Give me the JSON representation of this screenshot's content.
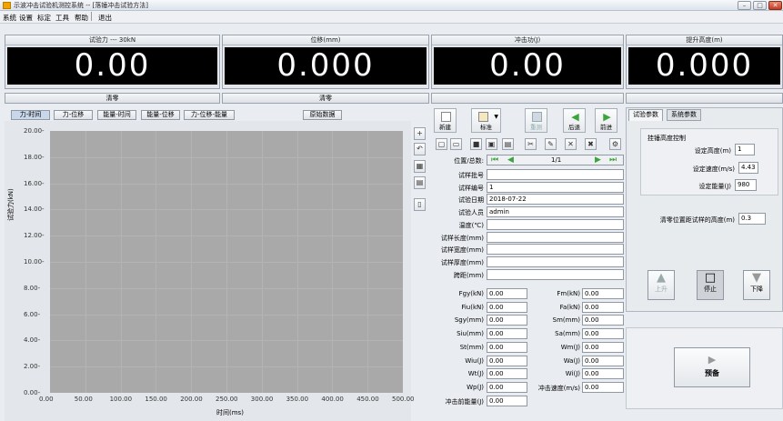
{
  "window": {
    "title": "示波冲击试验机测控系统 -- [落锤冲击试验方法]"
  },
  "menu": [
    "系统",
    "设置",
    "标定",
    "工具",
    "帮助",
    "退出"
  ],
  "displays": [
    {
      "caption": "试验力 --- 30kN",
      "value": "0.00"
    },
    {
      "caption": "位移(mm)",
      "value": "0.000"
    },
    {
      "caption": "冲击功(J)",
      "value": "0.00"
    },
    {
      "caption": "提升高度(m)",
      "value": "0.000"
    }
  ],
  "zero_buttons": [
    "清零",
    "清零"
  ],
  "chart_tabs": [
    "力-时间",
    "力-位移",
    "能量-时间",
    "能量-位移",
    "力-位移-能量"
  ],
  "raw_data_button": "原始数据",
  "chart_data": {
    "type": "line",
    "title": "",
    "xlabel": "时间(ms)",
    "ylabel": "试验力(kN)",
    "xlim": [
      0,
      500
    ],
    "ylim": [
      0,
      20
    ],
    "x_ticks": [
      "0.00",
      "50.00",
      "100.00",
      "150.00",
      "200.00",
      "250.00",
      "300.00",
      "350.00",
      "400.00",
      "450.00",
      "500.00"
    ],
    "y_ticks": [
      "0.00-",
      "2.00-",
      "4.00-",
      "6.00-",
      "8.00-",
      "10.00-",
      "12.00-",
      "14.00-",
      "16.00-",
      "18.00-",
      "20.00-"
    ],
    "series": [],
    "grid": true
  },
  "toolbar": {
    "new": "新建",
    "standard": "标准",
    "reset": "重测",
    "back": "后退",
    "forward": "前进"
  },
  "record": {
    "position_label": "位置/总数:",
    "position_value": "1/1"
  },
  "fields": [
    {
      "label": "试样批号",
      "value": ""
    },
    {
      "label": "试样编号",
      "value": "1"
    },
    {
      "label": "试验日期",
      "value": "2018-07-22"
    },
    {
      "label": "试验人员",
      "value": "admin"
    },
    {
      "label": "温度(℃)",
      "value": ""
    },
    {
      "label": "试样长度(mm)",
      "value": ""
    },
    {
      "label": "试样宽度(mm)",
      "value": ""
    },
    {
      "label": "试样厚度(mm)",
      "value": ""
    },
    {
      "label": "跨距(mm)",
      "value": ""
    }
  ],
  "results_left": [
    {
      "label": "Fgy(kN)",
      "value": "0.00"
    },
    {
      "label": "Fiu(kN)",
      "value": "0.00"
    },
    {
      "label": "Sgy(mm)",
      "value": "0.00"
    },
    {
      "label": "Siu(mm)",
      "value": "0.00"
    },
    {
      "label": "St(mm)",
      "value": "0.00"
    },
    {
      "label": "Wiu(J)",
      "value": "0.00"
    },
    {
      "label": "Wt(J)",
      "value": "0.00"
    },
    {
      "label": "Wp(J)",
      "value": "0.00"
    },
    {
      "label": "冲击前能量(J)",
      "value": "0.00"
    }
  ],
  "results_right": [
    {
      "label": "Fm(kN)",
      "value": "0.00"
    },
    {
      "label": "Fa(kN)",
      "value": "0.00"
    },
    {
      "label": "Sm(mm)",
      "value": "0.00"
    },
    {
      "label": "Sa(mm)",
      "value": "0.00"
    },
    {
      "label": "Wm(J)",
      "value": "0.00"
    },
    {
      "label": "Wa(J)",
      "value": "0.00"
    },
    {
      "label": "Wi(J)",
      "value": "0.00"
    },
    {
      "label": "冲击速度(m/s)",
      "value": "0.00"
    }
  ],
  "right_panel": {
    "tabs": [
      "试验参数",
      "系统参数"
    ],
    "group_title": "挂锤高度控制",
    "set_height_label": "设定高度(m)",
    "set_height": "1",
    "set_speed_label": "设定速度(m/s)",
    "set_speed": "4.43",
    "set_energy_label": "设定能量(J)",
    "set_energy": "980",
    "zero_pos_label": "清零位置距试样的高度(m)",
    "zero_pos": "0.3",
    "up": "上升",
    "stop": "停止",
    "down": "下降",
    "prestrike": "预备"
  },
  "colors": {
    "plot_bg": "#a9a9a9",
    "display_bg": "#000000",
    "arrow_green": "#3aa53a"
  }
}
